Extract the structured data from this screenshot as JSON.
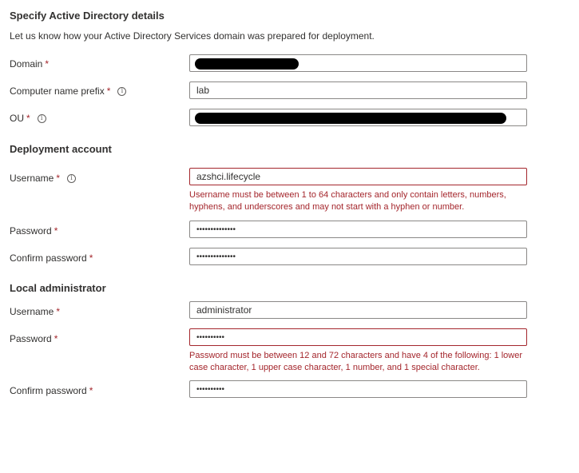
{
  "header": {
    "title": "Specify Active Directory details",
    "description": "Let us know how your Active Directory Services domain was prepared for deployment."
  },
  "fields": {
    "domain": {
      "label": "Domain",
      "required": "*",
      "value": ""
    },
    "computer_prefix": {
      "label": "Computer name prefix",
      "required": "*",
      "value": "lab",
      "info": "i"
    },
    "ou": {
      "label": "OU",
      "required": "*",
      "value": "",
      "info": "i"
    }
  },
  "deployment": {
    "section_title": "Deployment account",
    "username": {
      "label": "Username",
      "required": "*",
      "value": "azshci.lifecycle",
      "info": "i",
      "error": "Username must be between 1 to 64 characters and only contain letters, numbers, hyphens, and underscores and may not start with a hyphen or number."
    },
    "password": {
      "label": "Password",
      "required": "*",
      "value": "••••••••••••••"
    },
    "confirm": {
      "label": "Confirm password",
      "required": "*",
      "value": "••••••••••••••"
    }
  },
  "local_admin": {
    "section_title": "Local administrator",
    "username": {
      "label": "Username",
      "required": "*",
      "value": "administrator"
    },
    "password": {
      "label": "Password",
      "required": "*",
      "value": "••••••••••",
      "error": "Password must be between 12 and 72 characters and have 4 of the following: 1 lower case character, 1 upper case character, 1 number, and 1 special character."
    },
    "confirm": {
      "label": "Confirm password",
      "required": "*",
      "value": "••••••••••"
    }
  },
  "colors": {
    "error": "#a4262c",
    "border": "#8a8886",
    "text": "#323130"
  }
}
